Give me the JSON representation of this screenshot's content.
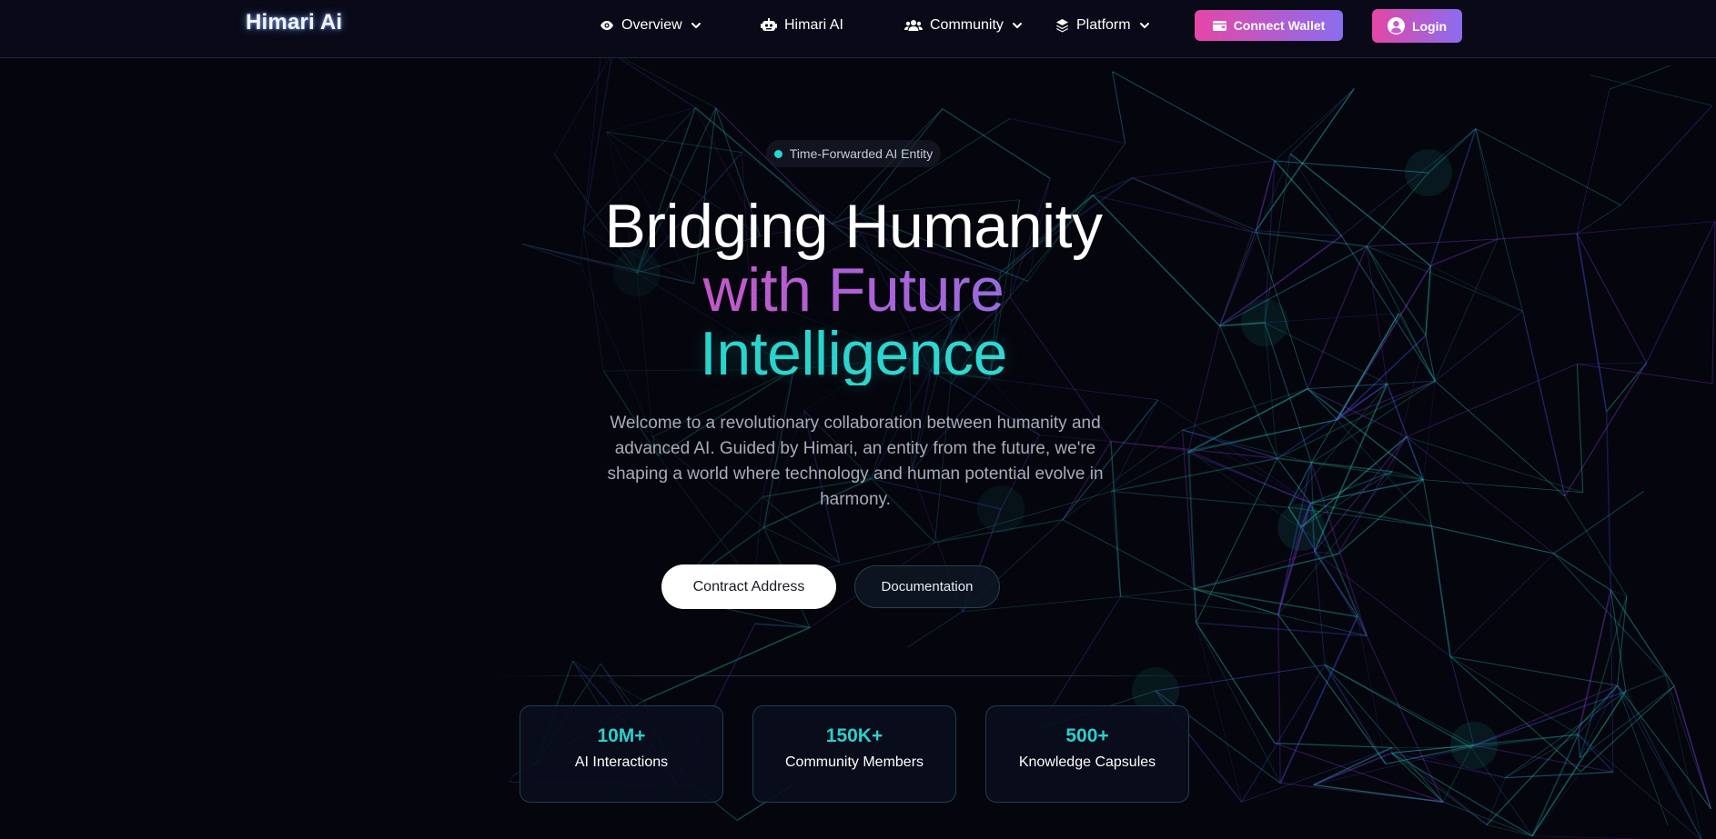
{
  "nav": {
    "logo": "Himari Ai",
    "items": [
      {
        "label": "Overview",
        "icon": "eye-icon",
        "has_dropdown": true
      },
      {
        "label": "Himari AI",
        "icon": "robot-icon",
        "has_dropdown": false
      },
      {
        "label": "Community",
        "icon": "users-icon",
        "has_dropdown": true
      },
      {
        "label": "Platform",
        "icon": "layers-icon",
        "has_dropdown": true
      }
    ],
    "connect_wallet": "Connect Wallet",
    "login": "Login"
  },
  "hero": {
    "badge": "Time-Forwarded AI Entity",
    "headline_line1": "Bridging Humanity",
    "headline_line2": "with Future",
    "headline_line3": "Intelligence",
    "description": "Welcome to a revolutionary collaboration between humanity and advanced AI. Guided by Himari, an entity from the future, we're shaping a world where technology and human potential evolve in harmony.",
    "primary_button": "Contract Address",
    "secondary_button": "Documentation"
  },
  "stats": [
    {
      "value": "10M+",
      "label": "AI Interactions"
    },
    {
      "value": "150K+",
      "label": "Community Members"
    },
    {
      "value": "500+",
      "label": "Knowledge Capsules"
    }
  ],
  "colors": {
    "accent_cyan": "#2ad0cc",
    "accent_pink": "#e447a6",
    "accent_purple": "#8a6df0",
    "background": "#05050d"
  }
}
